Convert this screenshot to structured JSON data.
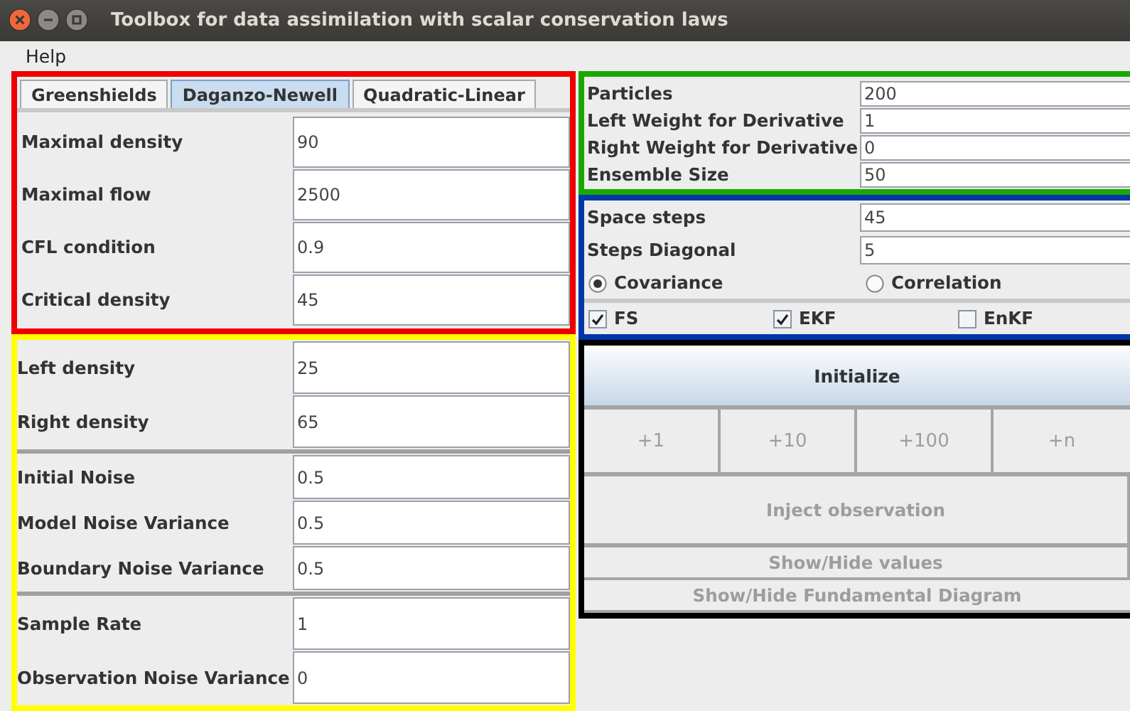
{
  "window": {
    "title": "Toolbox for data assimilation with scalar conservation laws"
  },
  "menu": [
    {
      "label": "Help"
    }
  ],
  "model_tabs": [
    {
      "label": "Greenshields",
      "selected": false
    },
    {
      "label": "Daganzo-Newell",
      "selected": true
    },
    {
      "label": "Quadratic-Linear",
      "selected": false
    }
  ],
  "model_parameters": [
    {
      "label": "Maximal density",
      "value": "90"
    },
    {
      "label": "Maximal flow",
      "value": "2500"
    },
    {
      "label": "CFL condition",
      "value": "0.9"
    },
    {
      "label": "Critical density",
      "value": "45"
    }
  ],
  "simulation_groups": [
    [
      {
        "label": "Left density",
        "value": "25"
      },
      {
        "label": "Right density",
        "value": "65"
      }
    ],
    [
      {
        "label": "Initial Noise",
        "value": "0.5"
      },
      {
        "label": "Model Noise Variance",
        "value": "0.5"
      },
      {
        "label": "Boundary Noise Variance",
        "value": "0.5"
      }
    ],
    [
      {
        "label": "Sample Rate",
        "value": "1"
      },
      {
        "label": "Observation Noise Variance",
        "value": "0"
      }
    ]
  ],
  "filter_parameters": [
    {
      "label": "Particles",
      "value": "200"
    },
    {
      "label": "Left Weight for Derivative",
      "value": "1"
    },
    {
      "label": "Right Weight for Derivative",
      "value": "0"
    },
    {
      "label": "Ensemble Size",
      "value": "50"
    }
  ],
  "covariance_parameters": [
    {
      "label": "Space steps",
      "value": "45"
    },
    {
      "label": "Steps Diagonal",
      "value": "5"
    }
  ],
  "matrix_type": [
    {
      "label": "Covariance",
      "selected": true
    },
    {
      "label": "Correlation",
      "selected": false
    }
  ],
  "filters": [
    {
      "label": "FS",
      "checked": true
    },
    {
      "label": "EKF",
      "checked": true
    },
    {
      "label": "EnKF",
      "checked": false
    }
  ],
  "initialize": {
    "label": "Initialize",
    "disabled": false
  },
  "step_buttons": [
    {
      "label": "+1",
      "disabled": true
    },
    {
      "label": "+10",
      "disabled": true
    },
    {
      "label": "+100",
      "disabled": true
    },
    {
      "label": "+n",
      "disabled": true
    }
  ],
  "action_buttons": [
    {
      "label": "Inject observation",
      "kind": "tall",
      "disabled": true
    },
    {
      "label": "Show/Hide values",
      "kind": "short",
      "disabled": true
    },
    {
      "label": "Show/Hide Fundamental Diagram",
      "kind": "short",
      "disabled": true
    }
  ]
}
